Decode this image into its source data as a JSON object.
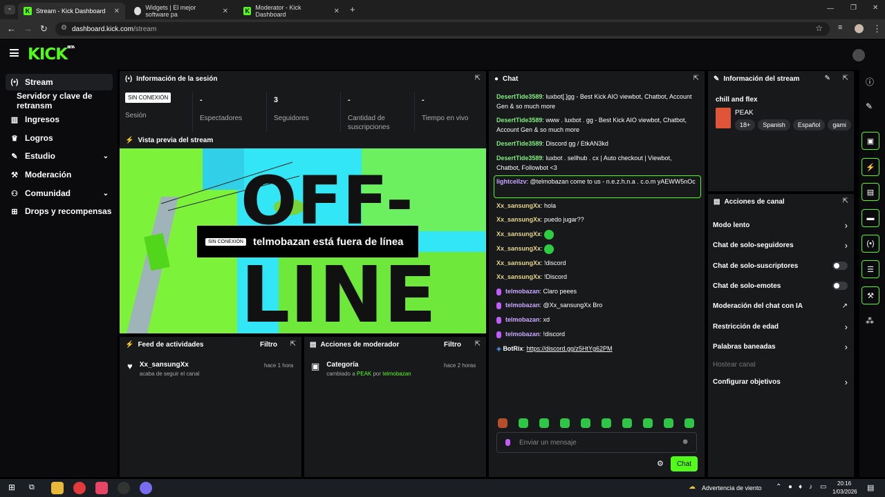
{
  "browser": {
    "tabs": [
      {
        "title": "Stream - Kick Dashboard"
      },
      {
        "title": "Widgets | El mejor software pa"
      },
      {
        "title": "Moderator - Kick Dashboard"
      }
    ],
    "url_host": "dashboard.kick.com",
    "url_path": "/stream"
  },
  "header": {
    "logo": "KICK",
    "logo_sup": "BETA"
  },
  "sidebar": {
    "items": [
      {
        "label": "Stream",
        "icon": "broadcast-icon"
      },
      {
        "label": "Servidor y clave de retransm",
        "icon": ""
      },
      {
        "label": "Ingresos",
        "icon": "chart-icon"
      },
      {
        "label": "Logros",
        "icon": "trophy-icon"
      },
      {
        "label": "Estudio",
        "icon": "pencil-icon"
      },
      {
        "label": "Moderación",
        "icon": "wrench-icon"
      },
      {
        "label": "Comunidad",
        "icon": "users-icon"
      },
      {
        "label": "Drops y recompensas",
        "icon": "gift-icon"
      }
    ]
  },
  "session": {
    "title": "Información de la sesión",
    "badge": "SIN CONEXIÓN",
    "stats": [
      {
        "label": "Sesión",
        "value": ""
      },
      {
        "label": "Espectadores",
        "value": "-"
      },
      {
        "label": "Seguidores",
        "value": "3"
      },
      {
        "label": "Cantidad de suscripciones",
        "value": "-"
      },
      {
        "label": "Tiempo en vivo",
        "value": "-"
      }
    ]
  },
  "preview": {
    "title": "Vista previa del stream",
    "badge": "SIN CONEXIÓN",
    "offline_text": "telmobazan está fuera de línea",
    "bg_text_1": "OFF-",
    "bg_text_2": "LINE"
  },
  "activity": {
    "title": "Feed de actividades",
    "filter": "Filtro",
    "item": {
      "name": "Xx_sansungXx",
      "sub": "acaba de seguir el canal",
      "time": "hace 1 hora"
    }
  },
  "modactions": {
    "title": "Acciones de moderador",
    "filter": "Filtro",
    "item": {
      "name": "Categoría",
      "sub1": "cambiado a ",
      "sub_game": "PEAK",
      "sub2": " por ",
      "sub_user": "telmobazan",
      "time": "hace 2 horas"
    }
  },
  "chat": {
    "title": "Chat",
    "messages": [
      {
        "user": "DesertTide3589",
        "text": "luxbot[.]gg - Best Kick AIO viewbot, Chatbot, Account Gen & so much more",
        "style": "u1"
      },
      {
        "user": "DesertTide3589",
        "text": "www . luxbot . gg - Best Kick AIO viewbot, Chatbot, Account Gen & so much more",
        "style": "u1"
      },
      {
        "user": "DesertTide3589",
        "text": "Discord gg / EtkAN3kd",
        "style": "u1"
      },
      {
        "user": "DesertTide3589",
        "text": "luxbot . sellhub . cx | Auto checkout | Viewbot, Chatbot, Followbot <3",
        "style": "u1"
      },
      {
        "user": "lightcellzv",
        "text": "@telmobazan come to us - n.e.z.h.n.a . c.o.m yAEWW5nOc",
        "style": "u3"
      },
      {
        "user": "Xx_sansungXx",
        "text": "hola",
        "style": "u2"
      },
      {
        "user": "Xx_sansungXx",
        "text": "puedo jugar??",
        "style": "u2"
      },
      {
        "user": "Xx_sansungXx",
        "text": "",
        "style": "u2"
      },
      {
        "user": "Xx_sansungXx",
        "text": "",
        "style": "u2"
      },
      {
        "user": "Xx_sansungXx",
        "text": "!discord",
        "style": "u2"
      },
      {
        "user": "Xx_sansungXx",
        "text": "!Discord",
        "style": "u2"
      },
      {
        "user": "telmobazan",
        "text": "Claro peees",
        "style": "u3"
      },
      {
        "user": "telmobazan",
        "text": "@Xx_sansungXx Bro",
        "style": "u3"
      },
      {
        "user": "telmobazan",
        "text": "xd",
        "style": "u3"
      },
      {
        "user": "telmobazan",
        "text": "!discord",
        "style": "u3"
      },
      {
        "user": "BotRix",
        "text": "https://discord.gg/z5HtYg62PM",
        "style": "u4"
      }
    ],
    "input_placeholder": "Enviar un mensaje",
    "send_label": "Chat"
  },
  "stream_info": {
    "title": "Información del stream",
    "stream_title": "chill and flex",
    "category": "PEAK",
    "tags": [
      "18+",
      "Spanish",
      "Español",
      "gami"
    ]
  },
  "channel_actions": {
    "title": "Acciones de canal",
    "rows": [
      {
        "label": "Modo lento",
        "control": "chevron"
      },
      {
        "label": "Chat de solo-seguidores",
        "control": "chevron"
      },
      {
        "label": "Chat de solo-suscriptores",
        "control": "toggle"
      },
      {
        "label": "Chat de solo-emotes",
        "control": "toggle"
      },
      {
        "label": "Moderación del chat con IA",
        "control": "external"
      },
      {
        "label": "Restricción de edad",
        "control": "chevron"
      },
      {
        "label": "Palabras baneadas",
        "control": "chevron"
      },
      {
        "label": "Hostear canal",
        "control": "none"
      },
      {
        "label": "Configurar objetivos",
        "control": "chevron"
      }
    ]
  },
  "taskbar": {
    "weather": "Advertencia de viento",
    "time": "20:16",
    "date": "1/03/2026"
  }
}
